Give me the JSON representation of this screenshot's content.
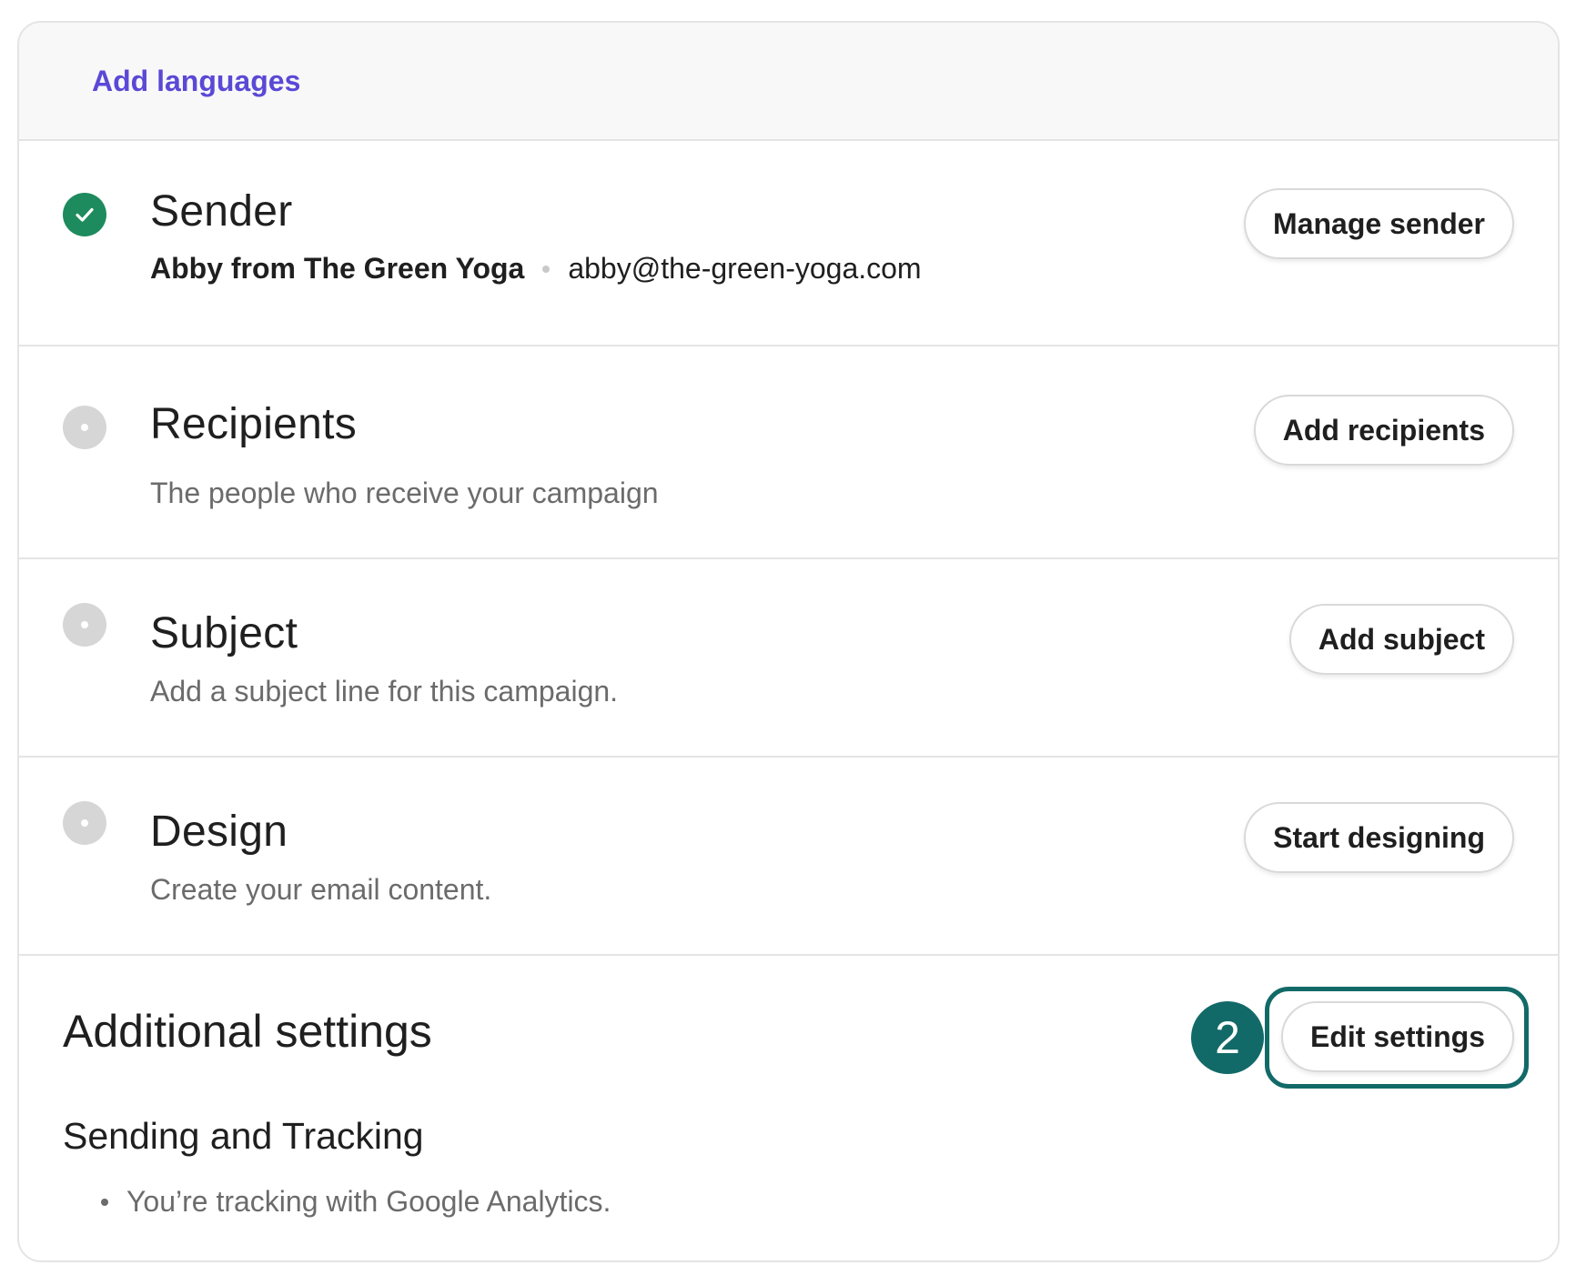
{
  "languages": {
    "link_label": "Add languages"
  },
  "sender": {
    "title": "Sender",
    "status": "complete",
    "status_icon": "check-icon",
    "name": "Abby from The Green Yoga",
    "email": "abby@the-green-yoga.com",
    "button_label": "Manage sender"
  },
  "recipients": {
    "title": "Recipients",
    "status": "incomplete",
    "subtitle": "The people who receive your campaign",
    "button_label": "Add recipients"
  },
  "subject": {
    "title": "Subject",
    "status": "incomplete",
    "subtitle": "Add a subject line for this campaign.",
    "button_label": "Add subject"
  },
  "design": {
    "title": "Design",
    "status": "incomplete",
    "subtitle": "Create your email content.",
    "button_label": "Start designing"
  },
  "additional": {
    "title": "Additional settings",
    "button_label": "Edit settings",
    "step_badge": "2",
    "subsection_title": "Sending and Tracking",
    "items": [
      "You’re tracking with Google Analytics."
    ]
  },
  "colors": {
    "link": "#5a49d6",
    "success": "#1d8b5e",
    "pending": "#d6d6d6",
    "highlight": "#126a68"
  }
}
